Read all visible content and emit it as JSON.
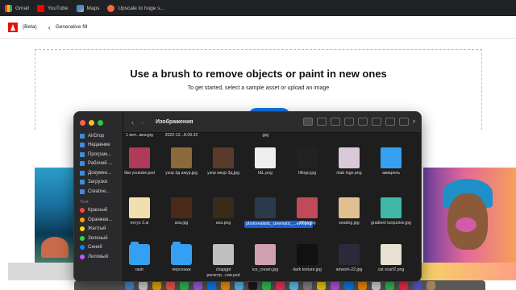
{
  "bookmarks": [
    {
      "label": "Gmail",
      "icon": "gmail-icon"
    },
    {
      "label": "YouTube",
      "icon": "youtube-icon"
    },
    {
      "label": "Maps",
      "icon": "maps-icon"
    },
    {
      "label": "Upscale to huge s...",
      "icon": "upscale-icon"
    }
  ],
  "header": {
    "beta_label": "(Beta)",
    "breadcrumb": "Generative fill"
  },
  "main": {
    "headline": "Use a brush to remove objects or paint in new ones",
    "subline": "To get started, select a sample asset or upload an image"
  },
  "finder": {
    "title": "Изображения",
    "sidebar": [
      {
        "label": "AirDrop",
        "icon": "airdrop-icon"
      },
      {
        "label": "Недавние",
        "icon": "clock-icon"
      },
      {
        "label": "Програм...",
        "icon": "apps-icon"
      },
      {
        "label": "Рабочий ...",
        "icon": "desktop-icon"
      },
      {
        "label": "Докумен...",
        "icon": "document-icon"
      },
      {
        "label": "Загрузки",
        "icon": "download-icon"
      },
      {
        "label": "Creative...",
        "icon": "cloud-icon"
      }
    ],
    "tags_heading": "Теги",
    "tags": [
      {
        "label": "Красный",
        "color": "#ff453a"
      },
      {
        "label": "Оранжев...",
        "color": "#ff9f0a"
      },
      {
        "label": "Желтый",
        "color": "#ffd60a"
      },
      {
        "label": "Зеленый",
        "color": "#32d74b"
      },
      {
        "label": "Синий",
        "color": "#0a84ff"
      },
      {
        "label": "Лиловый",
        "color": "#bf5af2"
      }
    ],
    "rows": [
      [
        "1 мот...жка.jpg",
        "2022-12...8.09.32",
        "",
        ".jpg",
        "",
        "",
        "",
        "эмб"
      ],
      [
        "бки youtube.psd",
        "узор 3д ажур.jpg",
        "узор ажур 3д.jpg",
        "I&L.png",
        "IIllogo.jpg",
        "nlab logo.png",
        "акварель",
        ""
      ],
      [
        "петух 2.ai",
        "ava.jpg",
        "ava.png",
        "photorealistic_cinematic_...e70.png",
        "pillow.jpg",
        "seadog.jpg",
        "gradient turquoise.jpg",
        "эмб"
      ],
      [
        "rastr",
        "персонаж",
        "chapgpt регистр...сии.psd",
        "ice_cream.jpg",
        "dark texture.jpg",
        "artwork-22.jpg",
        "cat scarf2.png",
        "cat"
      ]
    ]
  }
}
